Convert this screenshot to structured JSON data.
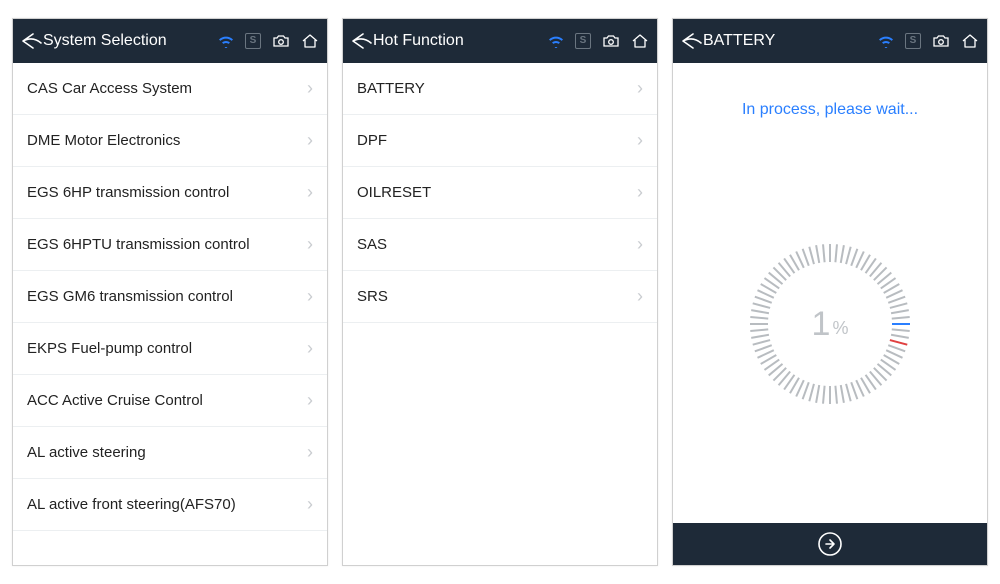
{
  "screens": [
    {
      "title": "System Selection",
      "items": [
        "CAS Car Access System",
        "DME Motor Electronics",
        "EGS 6HP transmission control",
        "EGS 6HPTU transmission control",
        "EGS GM6 transmission control",
        "EKPS Fuel-pump control",
        "ACC Active Cruise Control",
        "AL active steering",
        "AL active front steering(AFS70)"
      ]
    },
    {
      "title": "Hot Function",
      "items": [
        "BATTERY",
        "DPF",
        "OILRESET",
        "SAS",
        "SRS"
      ]
    },
    {
      "title": "BATTERY",
      "processText": "In process, please wait...",
      "percent": "1",
      "percentSign": "%"
    }
  ],
  "iconLabels": {
    "s": "S"
  }
}
